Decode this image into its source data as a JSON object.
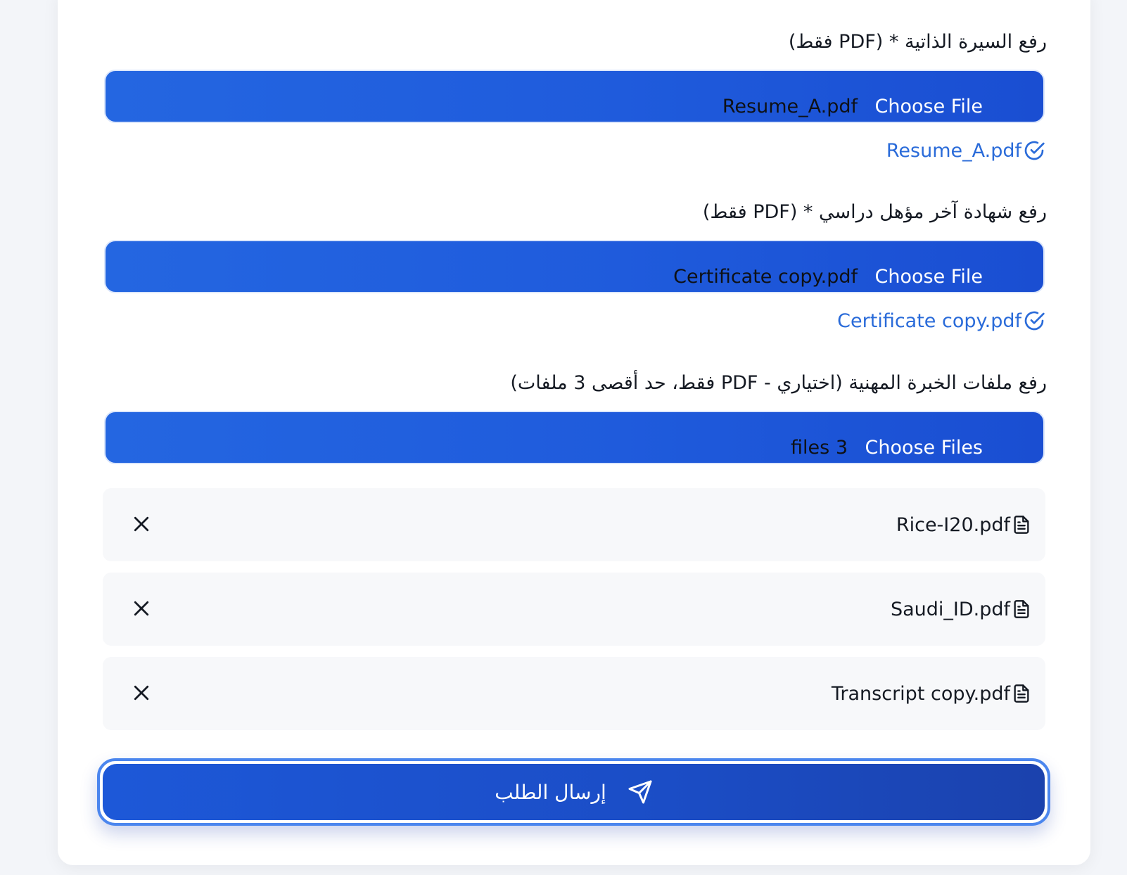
{
  "resume": {
    "label": "رفع السيرة الذاتية * (PDF فقط)",
    "button": "Choose File",
    "file_name": "Resume_A.pdf",
    "uploaded": "Resume_A.pdf"
  },
  "certificate": {
    "label": "رفع شهادة آخر مؤهل دراسي * (PDF فقط)",
    "button": "Choose File",
    "file_name": "Certificate copy.pdf",
    "uploaded": "Certificate copy.pdf"
  },
  "experience": {
    "label": "رفع ملفات الخبرة المهنية (اختياري - PDF فقط، حد أقصى 3 ملفات)",
    "button": "Choose Files",
    "file_count": "files 3",
    "files": [
      {
        "name": "Rice-I20.pdf"
      },
      {
        "name": "Saudi_ID.pdf"
      },
      {
        "name": "Transcript copy.pdf"
      }
    ]
  },
  "submit": {
    "label": "إرسال الطلب"
  },
  "icons": {
    "check": "check-circle-icon",
    "file": "file-text-icon",
    "remove": "close-icon",
    "send": "send-icon"
  },
  "colors": {
    "accent": "#1f5bdc",
    "link": "#2a6bd9",
    "submit": "#1b4dc6"
  }
}
